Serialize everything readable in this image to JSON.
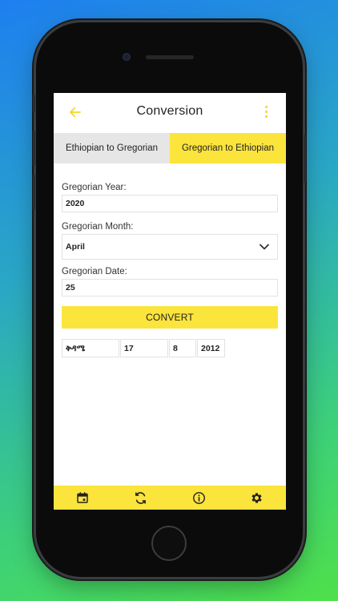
{
  "app_bar": {
    "title": "Conversion",
    "back_icon": "arrow-left-icon",
    "menu_icon": "more-vertical-icon",
    "accent": "#fbe43c"
  },
  "tabs": [
    {
      "label": "Ethiopian to Gregorian",
      "active": false
    },
    {
      "label": "Gregorian to Ethiopian",
      "active": true
    }
  ],
  "form": {
    "year_label": "Gregorian Year:",
    "year_value": "2020",
    "month_label": "Gregorian Month:",
    "month_value": "April",
    "date_label": "Gregorian Date:",
    "date_value": "25",
    "convert_label": "CONVERT"
  },
  "result": {
    "weekday": "ቅዳሜ",
    "day": "17",
    "month": "8",
    "year": "2012"
  },
  "bottom_nav": [
    {
      "icon": "calendar-icon"
    },
    {
      "icon": "sync-icon"
    },
    {
      "icon": "info-icon"
    },
    {
      "icon": "settings-icon"
    }
  ]
}
